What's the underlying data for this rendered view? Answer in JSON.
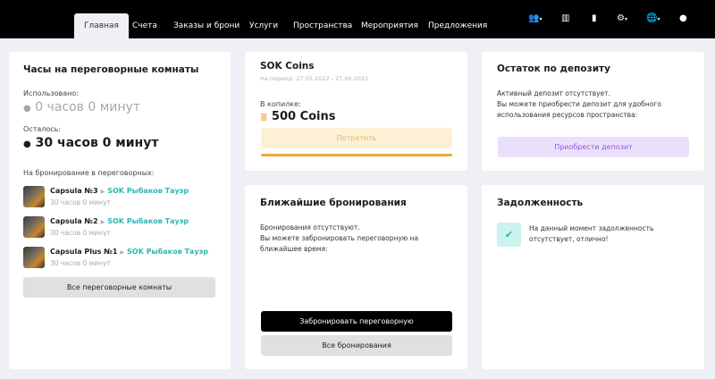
{
  "nav": {
    "tabs": [
      "Главная",
      "Счета",
      "Заказы и брони",
      "Услуги",
      "Пространства",
      "Мероприятия",
      "Предложения"
    ],
    "active": 0,
    "icons": [
      "users-icon",
      "chart-icon",
      "document-icon",
      "gears-icon",
      "globe-icon",
      "user-icon"
    ]
  },
  "hours": {
    "title": "Часы на переговорные комнаты",
    "used_label": "Использовано:",
    "used_value": "0 часов 0 минут",
    "left_label": "Осталось:",
    "left_value": "30 часов 0 минут",
    "booking_label": "На бронирование в переговорных:",
    "rooms": [
      {
        "name": "Capsula №3",
        "location": "SOK Рыбаков Тауэр",
        "time": "30 часов 0 минут"
      },
      {
        "name": "Capsula №2",
        "location": "SOK Рыбаков Тауэр",
        "time": "30 часов 0 минут"
      },
      {
        "name": "Capsula Plus №1",
        "location": "SOK Рыбаков Тауэр",
        "time": "30 часов 0 минут"
      }
    ],
    "all_button": "Все переговорные комнаты"
  },
  "coins": {
    "title": "SOK Coins",
    "period": "На период: 27.05.2022 - 27.06.2022",
    "balance_label": "В копилке:",
    "balance": "500 Coins",
    "spend_button": "Потратить",
    "progress_percent": 100,
    "accent": "#f0a93b"
  },
  "deposit": {
    "title": "Остаток по депозиту",
    "text1": "Активный депозит отсутствует.",
    "text2": "Вы можете приобрести депозит для удобного использования ресурсов пространства:",
    "button": "Приобрести депозит"
  },
  "bookings": {
    "title": "Ближайшие бронирования",
    "text1": "Бронирования отсутствуют.",
    "text2": "Вы можете забронировать переговорную на ближайшее время:",
    "book_button": "Забронировать переговорную",
    "all_button": "Все бронирования"
  },
  "debt": {
    "title": "Задолженность",
    "text": "На данный момент задолженность отсутствует, отлично!"
  }
}
